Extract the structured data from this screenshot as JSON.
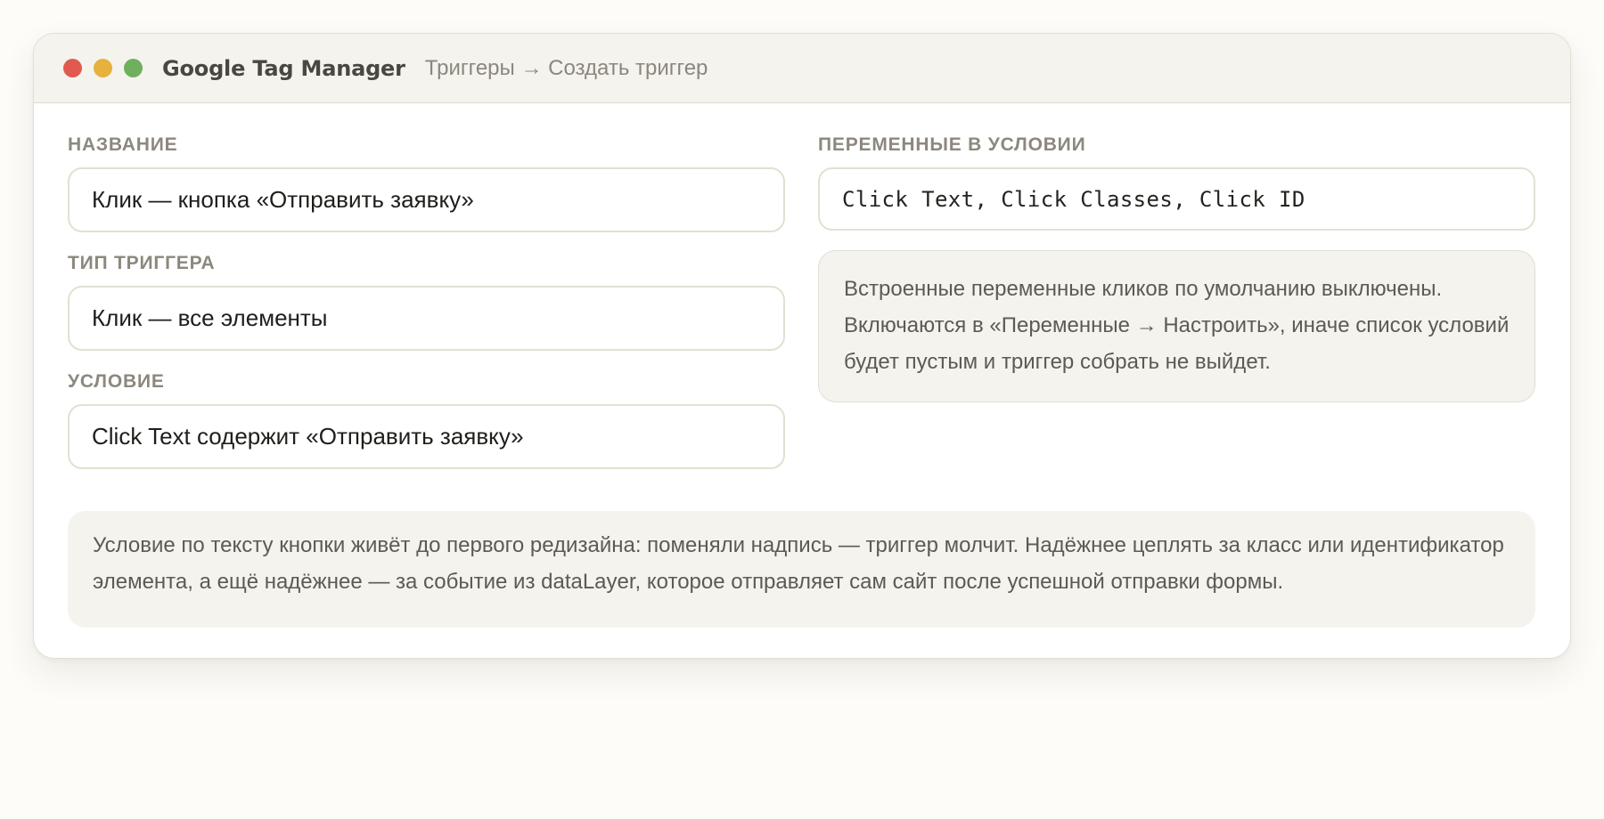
{
  "window": {
    "app_title": "Google Tag Manager",
    "breadcrumb": "Триггеры → Создать триггер"
  },
  "form": {
    "name_label": "Название",
    "name_value": "Клик — кнопка «Отправить заявку»",
    "trigger_type_label": "Тип триггера",
    "trigger_type_value": "Клик — все элементы",
    "condition_label": "Условие",
    "condition_value": "Click Text содержит «Отправить заявку»",
    "variables_label": "Переменные в условии",
    "variables_value": "Click Text, Click Classes, Click ID"
  },
  "notes": {
    "builtin_variables": "Встроенные переменные кликов по умолчанию выключены. Включаются в «Переменные → Настроить», иначе список условий будет пустым и триггер собрать не выйдет.",
    "fragility": "Условие по тексту кнопки живёт до первого редизайна: поменяли надпись — триггер молчит. Надёжнее цеплять за класс или идентификатор элемента, а ещё надёжнее — за событие из dataLayer, которое отправляет сам сайт после успешной отправки формы."
  },
  "colors": {
    "close_dot": "#e05a4f",
    "minimize_dot": "#e6b13c",
    "maximize_dot": "#6fb05f",
    "page_background": "#fdfcf8",
    "note_background": "#f5f3ee"
  }
}
